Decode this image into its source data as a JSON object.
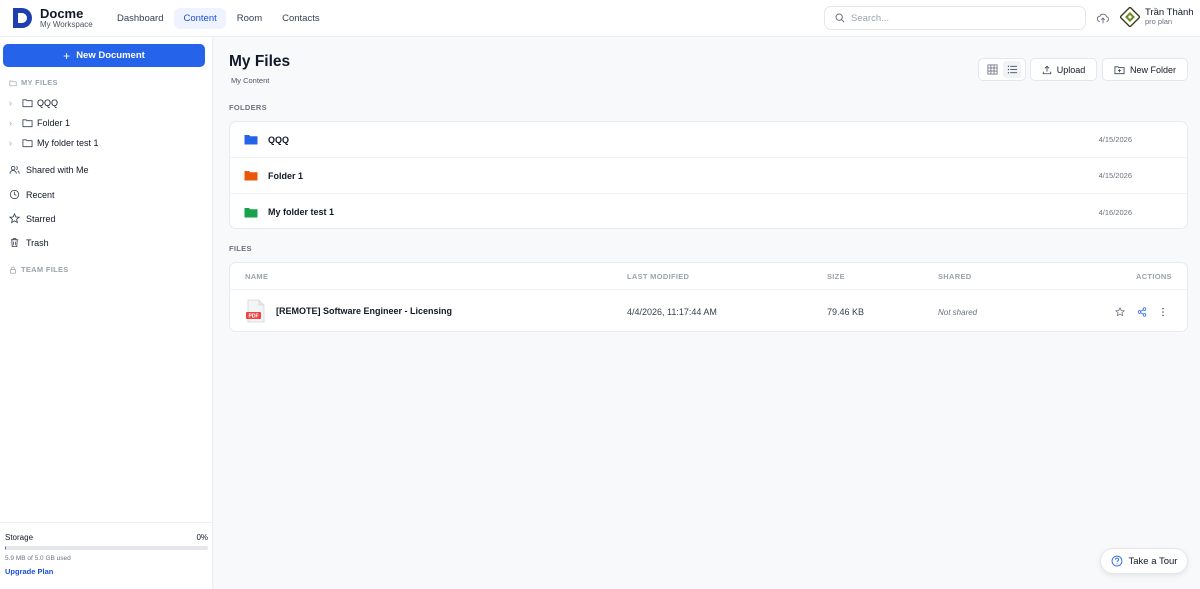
{
  "brand": {
    "name": "Docme",
    "workspace": "My Workspace"
  },
  "nav": {
    "items": [
      {
        "label": "Dashboard",
        "active": false
      },
      {
        "label": "Content",
        "active": true
      },
      {
        "label": "Room",
        "active": false
      },
      {
        "label": "Contacts",
        "active": false
      }
    ]
  },
  "search": {
    "placeholder": "Search...",
    "value": ""
  },
  "user": {
    "name": "Trần Thành",
    "plan": "pro plan"
  },
  "sidebar": {
    "new_document_label": "New Document",
    "my_files_label": "MY FILES",
    "folders": [
      {
        "label": "QQQ"
      },
      {
        "label": "Folder 1"
      },
      {
        "label": "My folder test 1"
      }
    ],
    "links": [
      {
        "label": "Shared with Me",
        "icon": "users-icon"
      },
      {
        "label": "Recent",
        "icon": "clock-icon"
      },
      {
        "label": "Starred",
        "icon": "star-icon"
      },
      {
        "label": "Trash",
        "icon": "trash-icon"
      }
    ],
    "team_files_label": "TEAM FILES",
    "storage": {
      "label": "Storage",
      "percent_label": "0%",
      "percent": 0.1,
      "used_text": "5.9 MB of 5.0 GB used",
      "upgrade_label": "Upgrade Plan"
    }
  },
  "main": {
    "title": "My Files",
    "subtitle": "My Content",
    "upload_label": "Upload",
    "new_folder_label": "New Folder",
    "folders_label": "FOLDERS",
    "folders": [
      {
        "name": "QQQ",
        "date": "4/15/2026",
        "color": "#2563eb"
      },
      {
        "name": "Folder 1",
        "date": "4/15/2026",
        "color": "#ea580c"
      },
      {
        "name": "My folder test 1",
        "date": "4/16/2026",
        "color": "#16a34a"
      }
    ],
    "files_label": "FILES",
    "columns": {
      "name": "NAME",
      "modified": "LAST MODIFIED",
      "size": "SIZE",
      "shared": "SHARED",
      "actions": "ACTIONS"
    },
    "files": [
      {
        "name": "[REMOTE] Software Engineer - Licensing",
        "type_label": "PDF",
        "modified": "4/4/2026, 11:17:44 AM",
        "size": "79.46 KB",
        "shared": "Not shared"
      }
    ]
  },
  "tour": {
    "label": "Take a Tour"
  },
  "colors": {
    "accent": "#2563eb",
    "pdf": "#ef4444"
  }
}
